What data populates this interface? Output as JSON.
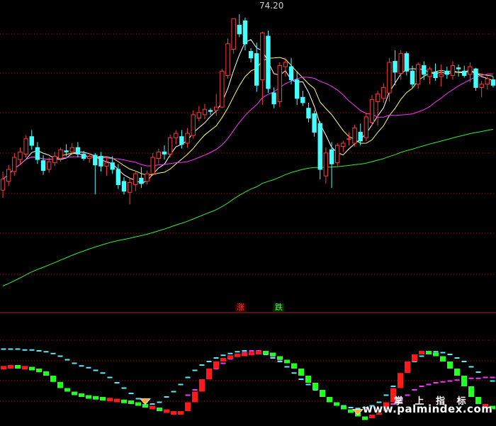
{
  "chart_data": [
    {
      "type": "candlestick",
      "price_high_label": "74.20",
      "ylim": [
        48,
        75
      ],
      "colors": {
        "up": "#ff3b3b",
        "down": "#44ffff",
        "ma5": "#ffffff",
        "ma10": "#ffff66",
        "ma20": "#ff33ff",
        "ma60": "#33ee33"
      },
      "candles": [
        {
          "o": 58.5,
          "h": 60.2,
          "l": 57.8,
          "c": 59.5
        },
        {
          "o": 59.3,
          "h": 60.8,
          "l": 58.9,
          "c": 60.4
        },
        {
          "o": 60.2,
          "h": 61.9,
          "l": 59.8,
          "c": 61.5
        },
        {
          "o": 61.3,
          "h": 62.4,
          "l": 60.8,
          "c": 62.0
        },
        {
          "o": 61.8,
          "h": 63.5,
          "l": 61.5,
          "c": 63.2
        },
        {
          "o": 63.4,
          "h": 64.0,
          "l": 62.2,
          "c": 62.6
        },
        {
          "o": 62.4,
          "h": 62.9,
          "l": 60.9,
          "c": 61.3
        },
        {
          "o": 61.2,
          "h": 61.7,
          "l": 59.9,
          "c": 60.3
        },
        {
          "o": 60.4,
          "h": 61.5,
          "l": 60.1,
          "c": 61.1
        },
        {
          "o": 61.0,
          "h": 62.0,
          "l": 60.7,
          "c": 61.6
        },
        {
          "o": 61.4,
          "h": 62.4,
          "l": 61.1,
          "c": 62.2
        },
        {
          "o": 62.1,
          "h": 62.7,
          "l": 61.6,
          "c": 62.0
        },
        {
          "o": 62.0,
          "h": 62.8,
          "l": 61.7,
          "c": 62.4
        },
        {
          "o": 62.4,
          "h": 62.9,
          "l": 61.5,
          "c": 61.8
        },
        {
          "o": 61.8,
          "h": 62.1,
          "l": 61.2,
          "c": 61.4
        },
        {
          "o": 61.4,
          "h": 61.9,
          "l": 61.0,
          "c": 61.6
        },
        {
          "o": 61.7,
          "h": 61.9,
          "l": 58.1,
          "c": 60.8
        },
        {
          "o": 61.6,
          "h": 62.0,
          "l": 60.2,
          "c": 60.7
        },
        {
          "o": 60.7,
          "h": 61.4,
          "l": 59.8,
          "c": 61.0
        },
        {
          "o": 61.0,
          "h": 61.6,
          "l": 60.0,
          "c": 60.4
        },
        {
          "o": 60.4,
          "h": 60.9,
          "l": 58.6,
          "c": 59.0
        },
        {
          "o": 59.3,
          "h": 59.7,
          "l": 58.1,
          "c": 58.4
        },
        {
          "o": 58.3,
          "h": 59.6,
          "l": 57.2,
          "c": 59.2
        },
        {
          "o": 59.0,
          "h": 60.3,
          "l": 58.4,
          "c": 60.0
        },
        {
          "o": 59.6,
          "h": 60.6,
          "l": 58.7,
          "c": 59.1
        },
        {
          "o": 59.3,
          "h": 60.3,
          "l": 59.0,
          "c": 60.0
        },
        {
          "o": 60.0,
          "h": 61.9,
          "l": 59.8,
          "c": 61.5
        },
        {
          "o": 61.4,
          "h": 62.3,
          "l": 60.9,
          "c": 62.0
        },
        {
          "o": 62.0,
          "h": 62.6,
          "l": 61.3,
          "c": 61.8
        },
        {
          "o": 61.8,
          "h": 63.6,
          "l": 61.5,
          "c": 63.3
        },
        {
          "o": 63.3,
          "h": 64.0,
          "l": 62.7,
          "c": 63.7
        },
        {
          "o": 63.4,
          "h": 64.0,
          "l": 62.3,
          "c": 62.7
        },
        {
          "o": 62.8,
          "h": 64.2,
          "l": 62.4,
          "c": 63.7
        },
        {
          "o": 63.5,
          "h": 65.8,
          "l": 63.2,
          "c": 65.4
        },
        {
          "o": 65.1,
          "h": 66.2,
          "l": 64.8,
          "c": 65.6
        },
        {
          "o": 65.4,
          "h": 66.4,
          "l": 65.0,
          "c": 65.9
        },
        {
          "o": 65.8,
          "h": 66.0,
          "l": 65.4,
          "c": 65.7
        },
        {
          "o": 65.8,
          "h": 67.3,
          "l": 65.3,
          "c": 66.1
        },
        {
          "o": 66.1,
          "h": 69.6,
          "l": 66.0,
          "c": 69.4
        },
        {
          "o": 69.0,
          "h": 72.4,
          "l": 68.7,
          "c": 71.9
        },
        {
          "o": 71.4,
          "h": 74.2,
          "l": 71.0,
          "c": 74.2
        },
        {
          "o": 73.6,
          "h": 74.6,
          "l": 72.5,
          "c": 72.8
        },
        {
          "o": 74.0,
          "h": 74.3,
          "l": 71.3,
          "c": 71.9
        },
        {
          "o": 71.2,
          "h": 71.5,
          "l": 70.2,
          "c": 70.6
        },
        {
          "o": 71.0,
          "h": 72.0,
          "l": 67.5,
          "c": 68.1
        },
        {
          "o": 68.6,
          "h": 73.0,
          "l": 66.3,
          "c": 72.9
        },
        {
          "o": 72.6,
          "h": 73.1,
          "l": 67.4,
          "c": 67.8
        },
        {
          "o": 67.4,
          "h": 67.9,
          "l": 66.0,
          "c": 66.4
        },
        {
          "o": 66.6,
          "h": 70.2,
          "l": 66.1,
          "c": 69.9
        },
        {
          "o": 69.8,
          "h": 70.6,
          "l": 68.9,
          "c": 70.2
        },
        {
          "o": 69.8,
          "h": 70.6,
          "l": 68.2,
          "c": 68.6
        },
        {
          "o": 68.6,
          "h": 69.4,
          "l": 66.3,
          "c": 66.9
        },
        {
          "o": 67.0,
          "h": 67.6,
          "l": 66.2,
          "c": 66.5
        },
        {
          "o": 66.0,
          "h": 66.5,
          "l": 64.7,
          "c": 65.1
        },
        {
          "o": 65.5,
          "h": 65.8,
          "l": 63.4,
          "c": 63.8
        },
        {
          "o": 64.6,
          "h": 64.8,
          "l": 59.5,
          "c": 60.4
        },
        {
          "o": 59.8,
          "h": 62.4,
          "l": 59.1,
          "c": 61.9
        },
        {
          "o": 62.2,
          "h": 62.9,
          "l": 58.7,
          "c": 60.9
        },
        {
          "o": 61.0,
          "h": 62.8,
          "l": 60.7,
          "c": 62.6
        },
        {
          "o": 62.5,
          "h": 63.0,
          "l": 62.0,
          "c": 62.8
        },
        {
          "o": 63.2,
          "h": 63.8,
          "l": 62.6,
          "c": 63.2
        },
        {
          "o": 62.8,
          "h": 64.5,
          "l": 62.5,
          "c": 64.2
        },
        {
          "o": 63.8,
          "h": 64.6,
          "l": 62.6,
          "c": 63.0
        },
        {
          "o": 63.3,
          "h": 65.6,
          "l": 63.0,
          "c": 65.2
        },
        {
          "o": 64.7,
          "h": 67.2,
          "l": 64.4,
          "c": 66.8
        },
        {
          "o": 66.6,
          "h": 67.6,
          "l": 64.4,
          "c": 67.3
        },
        {
          "o": 66.9,
          "h": 68.3,
          "l": 66.5,
          "c": 67.9
        },
        {
          "o": 67.4,
          "h": 70.6,
          "l": 66.6,
          "c": 70.2
        },
        {
          "o": 70.3,
          "h": 71.3,
          "l": 68.1,
          "c": 69.3
        },
        {
          "o": 69.2,
          "h": 71.3,
          "l": 68.6,
          "c": 71.0
        },
        {
          "o": 71.0,
          "h": 71.2,
          "l": 69.0,
          "c": 69.4
        },
        {
          "o": 69.4,
          "h": 69.9,
          "l": 67.9,
          "c": 68.2
        },
        {
          "o": 68.2,
          "h": 70.2,
          "l": 67.8,
          "c": 70.0
        },
        {
          "o": 69.9,
          "h": 70.3,
          "l": 68.6,
          "c": 69.1
        },
        {
          "o": 68.9,
          "h": 69.8,
          "l": 68.2,
          "c": 69.6
        },
        {
          "o": 69.3,
          "h": 70.1,
          "l": 68.5,
          "c": 68.8
        },
        {
          "o": 68.9,
          "h": 70.0,
          "l": 68.0,
          "c": 69.1
        },
        {
          "o": 69.4,
          "h": 69.8,
          "l": 68.7,
          "c": 69.1
        },
        {
          "o": 69.0,
          "h": 70.3,
          "l": 68.6,
          "c": 69.9
        },
        {
          "o": 69.7,
          "h": 70.0,
          "l": 68.9,
          "c": 69.6
        },
        {
          "o": 69.4,
          "h": 69.9,
          "l": 68.8,
          "c": 69.0
        },
        {
          "o": 69.1,
          "h": 70.2,
          "l": 68.4,
          "c": 69.8
        },
        {
          "o": 69.6,
          "h": 69.7,
          "l": 67.6,
          "c": 67.9
        },
        {
          "o": 67.9,
          "h": 68.5,
          "l": 67.0,
          "c": 68.2
        },
        {
          "o": 68.2,
          "h": 68.9,
          "l": 67.7,
          "c": 68.7
        },
        {
          "o": 68.6,
          "h": 68.9,
          "l": 67.9,
          "c": 68.1
        }
      ]
    },
    {
      "type": "indicator",
      "rise_label": "涨",
      "fall_label": "跌",
      "colors": {
        "rise": "#ff1a1a",
        "fall": "#22ff22",
        "line_a": "#55eeff",
        "line_b": "#ff33ff",
        "marker": "#ffaa33"
      },
      "signals": [
        4,
        7,
        14,
        23,
        34,
        39,
        50,
        57,
        66,
        72,
        78,
        84
      ],
      "bars": [
        {
          "v": 0.63,
          "d": 1
        },
        {
          "v": 0.64,
          "d": 1
        },
        {
          "v": 0.63,
          "d": -1
        },
        {
          "v": 0.62,
          "d": 1
        },
        {
          "v": 0.6,
          "d": -1
        },
        {
          "v": 0.57,
          "d": -1
        },
        {
          "v": 0.52,
          "d": -1
        },
        {
          "v": 0.45,
          "d": -1
        },
        {
          "v": 0.38,
          "d": -1
        },
        {
          "v": 0.34,
          "d": -1
        },
        {
          "v": 0.32,
          "d": -1
        },
        {
          "v": 0.3,
          "d": -1
        },
        {
          "v": 0.29,
          "d": -1
        },
        {
          "v": 0.28,
          "d": -1
        },
        {
          "v": 0.27,
          "d": -1
        },
        {
          "v": 0.26,
          "d": 1
        },
        {
          "v": 0.25,
          "d": 1
        },
        {
          "v": 0.24,
          "d": -1
        },
        {
          "v": 0.22,
          "d": -1
        },
        {
          "v": 0.2,
          "d": -1
        },
        {
          "v": 0.18,
          "d": -1
        },
        {
          "v": 0.16,
          "d": 1
        },
        {
          "v": 0.14,
          "d": -1
        },
        {
          "v": 0.12,
          "d": 1
        },
        {
          "v": 0.1,
          "d": 1
        },
        {
          "v": 0.12,
          "d": 1
        },
        {
          "v": 0.22,
          "d": 1
        },
        {
          "v": 0.34,
          "d": 1
        },
        {
          "v": 0.48,
          "d": 1
        },
        {
          "v": 0.6,
          "d": 1
        },
        {
          "v": 0.68,
          "d": 1
        },
        {
          "v": 0.72,
          "d": 1
        },
        {
          "v": 0.75,
          "d": 1
        },
        {
          "v": 0.77,
          "d": 1
        },
        {
          "v": 0.78,
          "d": 1
        },
        {
          "v": 0.79,
          "d": 1
        },
        {
          "v": 0.8,
          "d": 1
        },
        {
          "v": 0.78,
          "d": -1
        },
        {
          "v": 0.74,
          "d": -1
        },
        {
          "v": 0.7,
          "d": -1
        },
        {
          "v": 0.66,
          "d": -1
        },
        {
          "v": 0.6,
          "d": -1
        },
        {
          "v": 0.52,
          "d": -1
        },
        {
          "v": 0.44,
          "d": -1
        },
        {
          "v": 0.36,
          "d": -1
        },
        {
          "v": 0.28,
          "d": -1
        },
        {
          "v": 0.22,
          "d": -1
        },
        {
          "v": 0.18,
          "d": -1
        },
        {
          "v": 0.14,
          "d": -1
        },
        {
          "v": 0.1,
          "d": -1
        },
        {
          "v": 0.06,
          "d": -1
        },
        {
          "v": 0.04,
          "d": -1
        },
        {
          "v": 0.08,
          "d": 1
        },
        {
          "v": 0.12,
          "d": 1
        },
        {
          "v": 0.22,
          "d": 1
        },
        {
          "v": 0.38,
          "d": 1
        },
        {
          "v": 0.55,
          "d": 1
        },
        {
          "v": 0.68,
          "d": 1
        },
        {
          "v": 0.76,
          "d": 1
        },
        {
          "v": 0.8,
          "d": 1
        },
        {
          "v": 0.78,
          "d": -1
        },
        {
          "v": 0.74,
          "d": -1
        },
        {
          "v": 0.68,
          "d": -1
        },
        {
          "v": 0.6,
          "d": -1
        },
        {
          "v": 0.52,
          "d": -1
        },
        {
          "v": 0.4,
          "d": -1
        },
        {
          "v": 0.28,
          "d": -1
        },
        {
          "v": 0.2,
          "d": -1
        },
        {
          "v": 0.18,
          "d": 1
        },
        {
          "v": 0.17,
          "d": -1
        }
      ],
      "line_a": [
        0.82,
        0.82,
        0.82,
        0.81,
        0.81,
        0.8,
        0.79,
        0.77,
        0.74,
        0.7,
        0.66,
        0.63,
        0.61,
        0.58,
        0.55,
        0.5,
        0.44,
        0.38,
        0.32,
        0.26,
        0.22,
        0.2,
        0.22,
        0.28,
        0.34,
        0.42,
        0.5,
        0.58,
        0.64,
        0.68,
        0.72,
        0.75,
        0.77,
        0.79,
        0.8,
        0.8,
        0.79,
        0.76,
        0.72,
        0.68,
        0.62,
        0.55,
        0.48,
        0.42,
        0.36,
        0.3,
        0.25,
        0.21,
        0.18,
        0.16,
        0.15,
        0.16,
        0.18,
        0.22,
        0.3,
        0.4,
        0.5,
        0.6,
        0.68,
        0.74,
        0.78,
        0.79,
        0.78,
        0.76,
        0.72,
        0.68,
        0.62,
        0.56,
        0.5,
        0.46
      ],
      "line_b": [
        null,
        null,
        null,
        null,
        null,
        null,
        null,
        null,
        null,
        null,
        null,
        null,
        null,
        null,
        null,
        null,
        null,
        null,
        null,
        null,
        null,
        null,
        null,
        null,
        null,
        null,
        0.3,
        0.36,
        0.44,
        0.52,
        0.6,
        0.66,
        0.71,
        0.75,
        0.78,
        0.8,
        0.8,
        0.78,
        0.74,
        0.7,
        null,
        null,
        null,
        null,
        null,
        null,
        null,
        null,
        null,
        null,
        null,
        null,
        null,
        null,
        null,
        0.2,
        0.24,
        0.3,
        0.36,
        0.4,
        0.42,
        0.44,
        0.45,
        0.46,
        0.47,
        0.48,
        0.49,
        0.49,
        0.5,
        0.5
      ]
    }
  ],
  "watermark": {
    "title": "掌 上 指 标",
    "url": "www.palmindex.com"
  }
}
